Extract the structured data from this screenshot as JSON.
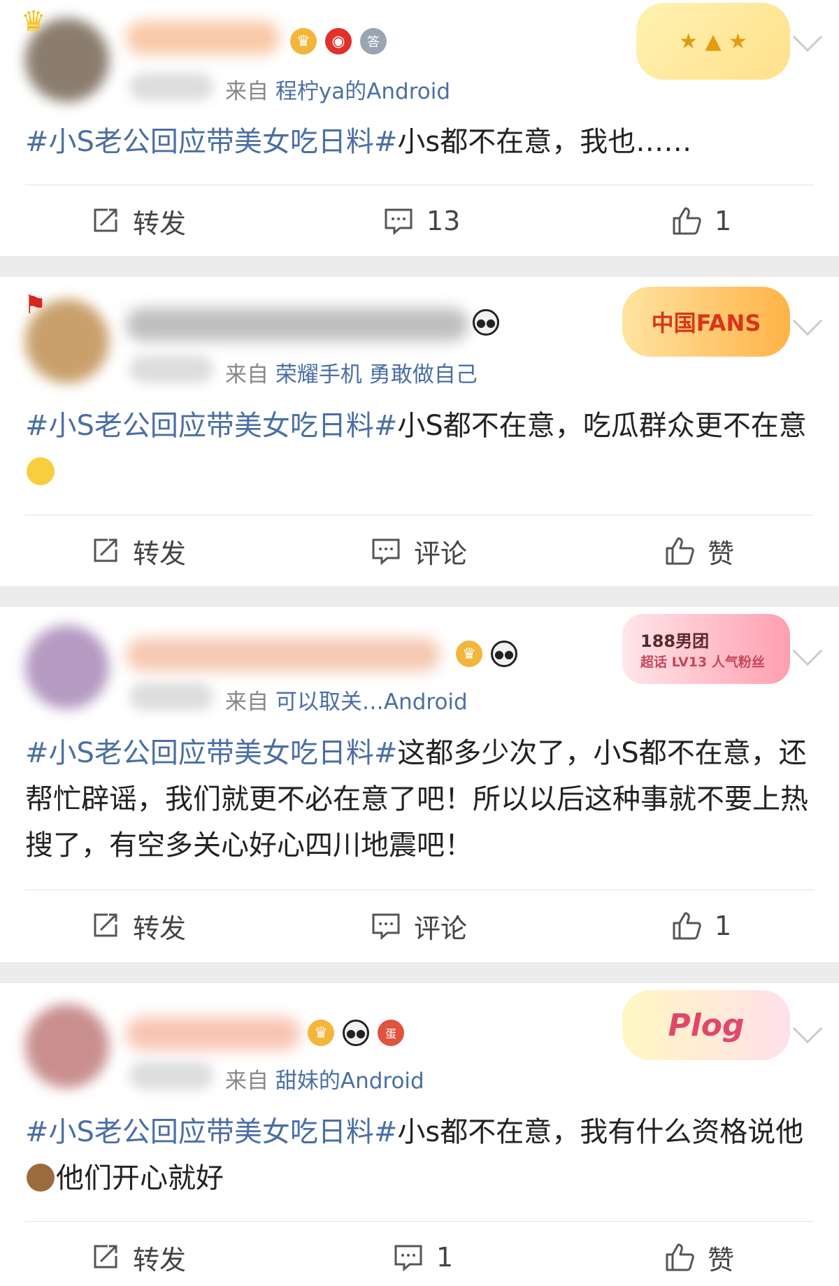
{
  "posts": [
    {
      "source_prefix": "来自",
      "source_device": "程柠ya的Android",
      "hashtag": "#小S老公回应带美女吃日料#",
      "text": "小s都不在意，我也……",
      "text2": "",
      "actions": {
        "repost": "转发",
        "comment": "13",
        "like": "1"
      }
    },
    {
      "source_prefix": "来自",
      "source_device": "荣耀手机 勇敢做自己",
      "hashtag": "#小S老公回应带美女吃日料#",
      "text": "小S都不在意，吃瓜群众更不在意",
      "text2": "",
      "deco_label": "中国FANS",
      "actions": {
        "repost": "转发",
        "comment": "评论",
        "like": "赞"
      }
    },
    {
      "source_prefix": "来自",
      "source_device": "可以取关…Android",
      "hashtag": "#小S老公回应带美女吃日料#",
      "text": "这都多少次了，小S都不在意，还帮忙辟谣，我们就更不必在意了吧！所以以后这种事就不要上热搜了，有空多关心好心四川地震吧！",
      "text2": "",
      "deco_label": "188男团",
      "deco_sub": "超话 LV13 人气粉丝",
      "actions": {
        "repost": "转发",
        "comment": "评论",
        "like": "1"
      }
    },
    {
      "source_prefix": "来自",
      "source_device": "甜妹的Android",
      "hashtag": "#小S老公回应带美女吃日料#",
      "text": "小s都不在意，我有什么资格说他",
      "text2": "他们开心就好",
      "deco_label": "Plog",
      "actions": {
        "repost": "转发",
        "comment": "1",
        "like": "赞"
      }
    }
  ],
  "colors": {
    "link": "#4a6fa5",
    "page_bg": "#ececec"
  },
  "icons": {
    "repost": "share-box-icon",
    "comment": "comment-bubble-icon",
    "like": "thumbs-up-icon"
  }
}
